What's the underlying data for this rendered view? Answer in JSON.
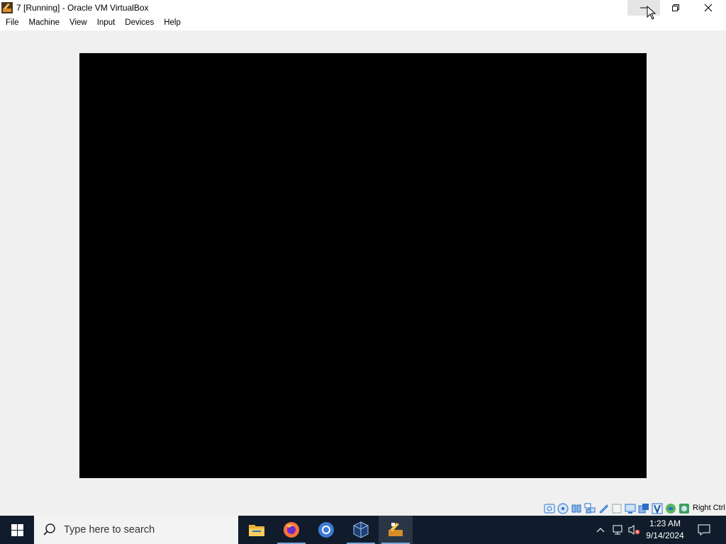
{
  "window": {
    "title": "7 [Running] - Oracle VM VirtualBox"
  },
  "menu": {
    "items": [
      "File",
      "Machine",
      "View",
      "Input",
      "Devices",
      "Help"
    ]
  },
  "statusbar": {
    "icons": [
      "hard-disk-icon",
      "optical-drive-icon",
      "audio-icon",
      "network-icon",
      "usb-icon",
      "shared-folder-icon",
      "display-icon",
      "recording-icon",
      "mouse-integration-icon",
      "capture-icon",
      "cpu-icon",
      "vt-x-icon",
      "guest-additions-icon"
    ],
    "host_key": "Right Ctrl"
  },
  "taskbar": {
    "search_placeholder": "Type here to search",
    "apps": [
      "file-explorer-icon",
      "firefox-icon",
      "chrome-icon",
      "virtualbox-manager-icon",
      "virtualbox-vm-icon"
    ],
    "time": "1:23 AM",
    "date": "9/14/2024"
  },
  "colors": {
    "taskbar": "#101c2b",
    "vm_screen": "#000000",
    "window_bg": "#f0f0f0"
  }
}
